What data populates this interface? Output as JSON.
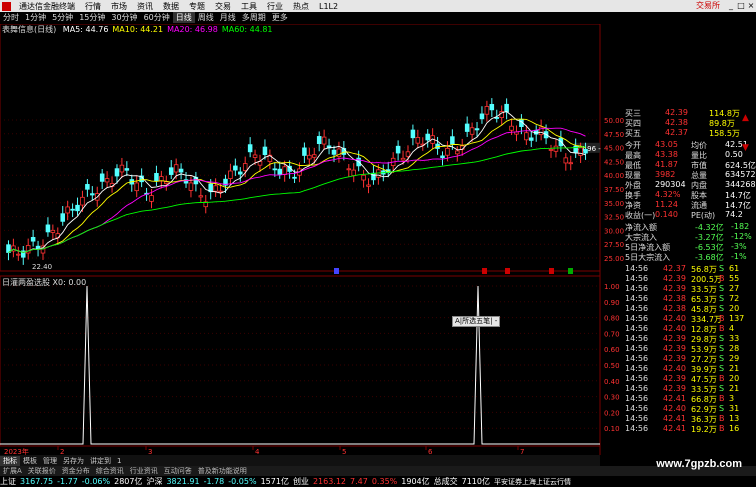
{
  "menubar": {
    "app_name": "通达信金融终端",
    "items": [
      "行情",
      "市场",
      "资讯",
      "数据",
      "专题",
      "交易",
      "工具",
      "行业",
      "热点",
      "L1L2"
    ],
    "trade_label": "交易所"
  },
  "periods": {
    "items": [
      "分时",
      "1分钟",
      "5分钟",
      "15分钟",
      "30分钟",
      "60分钟",
      "日线",
      "周线",
      "月线",
      "多周期",
      "更多"
    ],
    "active": "日线"
  },
  "ma_legend": {
    "title": "表舞信息(日线)",
    "items": [
      {
        "label": "MA5: 44.76",
        "color": "#ffffff"
      },
      {
        "label": "MA10: 44.21",
        "color": "#ffff00"
      },
      {
        "label": "MA20: 46.98",
        "color": "#ff00ff"
      },
      {
        "label": "MA60: 44.81",
        "color": "#00ff00"
      }
    ]
  },
  "price_axis": {
    "labels": [
      "50.00",
      "47.50",
      "45.00",
      "42.50",
      "40.00",
      "37.50",
      "35.00",
      "32.50",
      "30.00",
      "27.50",
      "25.00"
    ],
    "lower": "22.40",
    "last_price_marker": "44.96"
  },
  "indicator": {
    "legend": "日灌两盈选股 X0: 0.00",
    "axis": [
      "1.00",
      "0.90",
      "0.80",
      "0.70",
      "0.60",
      "0.50",
      "0.40",
      "0.30",
      "0.20",
      "0.10"
    ],
    "popup": "A|所选五笔| -"
  },
  "time_axis": {
    "labels": [
      "2023年",
      "2",
      "3",
      "4",
      "5",
      "6",
      "7"
    ]
  },
  "quote": {
    "sells": [
      {
        "label": "买三",
        "price": "42.39",
        "vol": "114.8万"
      },
      {
        "label": "买四",
        "price": "42.38",
        "vol": "89.8万"
      },
      {
        "label": "买五",
        "price": "42.37",
        "vol": "158.5万"
      }
    ],
    "stats": [
      {
        "l1": "今开",
        "v1": "43.05",
        "l2": "均价",
        "v2": "42.51"
      },
      {
        "l1": "最高",
        "v1": "43.38",
        "l2": "量比",
        "v2": "0.50"
      },
      {
        "l1": "最低",
        "v1": "41.87",
        "l2": "市值",
        "v2": "624.5亿"
      },
      {
        "l1": "现量",
        "v1": "3982",
        "l2": "总量",
        "v2": "634572"
      },
      {
        "l1": "外盘",
        "v1": "290304",
        "l2": "内盘",
        "v2": "344268"
      },
      {
        "l1": "换手",
        "v1": "4.32%",
        "l2": "股本",
        "v2": "14.7亿"
      },
      {
        "l1": "净资",
        "v1": "11.24",
        "l2": "流通",
        "v2": "14.7亿"
      },
      {
        "l1": "收益(一)",
        "v1": "0.140",
        "l2": "PE(动)",
        "v2": "74.2"
      }
    ],
    "flows": [
      {
        "label": "净流入额",
        "value": "-4.32亿",
        "pct": "-182"
      },
      {
        "label": "大宗流入",
        "value": "-3.27亿",
        "pct": "-12%"
      },
      {
        "label": "5日净流入额",
        "value": "-6.53亿",
        "pct": "-3%"
      },
      {
        "label": "5日大宗流入",
        "value": "-3.68亿",
        "pct": "-1%"
      }
    ],
    "ticks": [
      {
        "t": "14:56",
        "p": "42.37",
        "v": "56.8万",
        "d": "S",
        "n": "61"
      },
      {
        "t": "14:56",
        "p": "42.39",
        "v": "200.5万",
        "d": "B",
        "n": "55"
      },
      {
        "t": "14:56",
        "p": "42.39",
        "v": "33.5万",
        "d": "S",
        "n": "27"
      },
      {
        "t": "14:56",
        "p": "42.38",
        "v": "65.3万",
        "d": "S",
        "n": "72"
      },
      {
        "t": "14:56",
        "p": "42.38",
        "v": "45.8万",
        "d": "S",
        "n": "20"
      },
      {
        "t": "14:56",
        "p": "42.40",
        "v": "334.7万",
        "d": "B",
        "n": "137"
      },
      {
        "t": "14:56",
        "p": "42.40",
        "v": "12.8万",
        "d": "B",
        "n": "4"
      },
      {
        "t": "14:56",
        "p": "42.39",
        "v": "29.8万",
        "d": "S",
        "n": "33"
      },
      {
        "t": "14:56",
        "p": "42.39",
        "v": "53.9万",
        "d": "S",
        "n": "28"
      },
      {
        "t": "14:56",
        "p": "42.39",
        "v": "27.2万",
        "d": "S",
        "n": "29"
      },
      {
        "t": "14:56",
        "p": "42.40",
        "v": "39.9万",
        "d": "S",
        "n": "21"
      },
      {
        "t": "14:56",
        "p": "42.39",
        "v": "47.5万",
        "d": "B",
        "n": "20"
      },
      {
        "t": "14:56",
        "p": "42.39",
        "v": "33.5万",
        "d": "S",
        "n": "21"
      },
      {
        "t": "14:56",
        "p": "42.41",
        "v": "66.8万",
        "d": "B",
        "n": "3"
      },
      {
        "t": "14:56",
        "p": "42.40",
        "v": "62.9万",
        "d": "S",
        "n": "31"
      },
      {
        "t": "14:56",
        "p": "42.41",
        "v": "36.3万",
        "d": "B",
        "n": "13"
      },
      {
        "t": "14:56",
        "p": "42.41",
        "v": "19.2万",
        "d": "B",
        "n": "16"
      }
    ]
  },
  "tabs": [
    "指标",
    "模板",
    "管理",
    "另存为",
    "讲定到",
    "1"
  ],
  "subtabs": [
    "扩展A",
    "关联报价",
    "资金分布",
    "综合资讯",
    "行业资讯",
    "互动问答",
    "普及新功能说明"
  ],
  "watermark": "www.7gpzb.com",
  "status": {
    "sh_label": "上证",
    "sh_val": "3167.75",
    "sh_chg": "-1.77",
    "sh_pct": "-0.06%",
    "sh_amt": "2807亿",
    "sz_label": "沪深",
    "sz_val": "3821.91",
    "sz_chg": "-1.78",
    "sz_pct": "-0.05%",
    "sz_amt": "1571亿",
    "cy_label": "创业",
    "cy_val": "2163.12",
    "cy_chg": "7.47",
    "cy_pct": "0.35%",
    "cy_amt": "1904亿",
    "total_label": "总成交",
    "total_val": "7110亿",
    "broker": "平安证券上海上证云行情"
  },
  "colors": {
    "up": "#ff3232",
    "down": "#54ffff",
    "ma5": "#ffffff",
    "ma10": "#ffff00",
    "ma20": "#ff00ff",
    "ma60": "#00ff00",
    "grid": "#7a0000"
  }
}
